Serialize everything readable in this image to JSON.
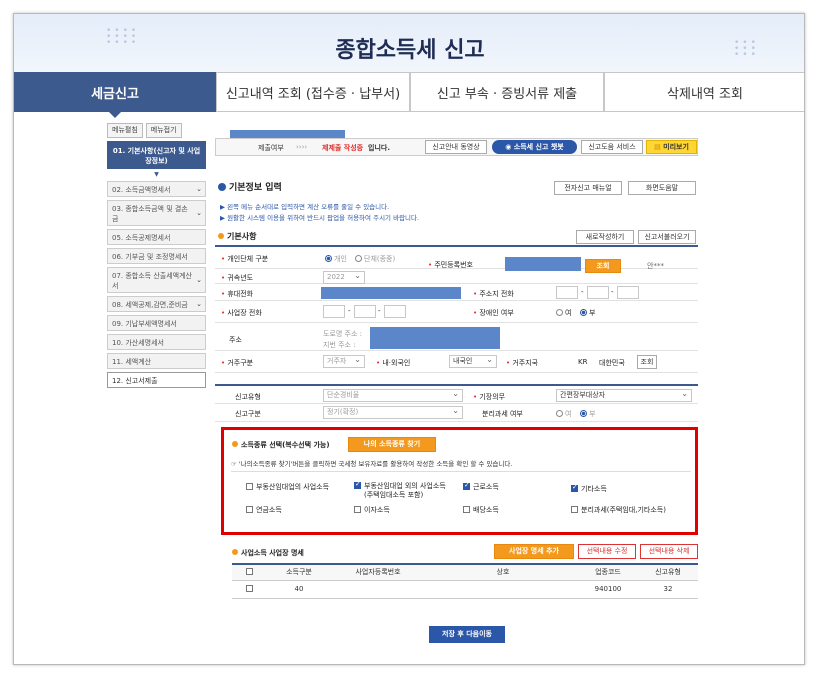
{
  "page_title": "종합소득세 신고",
  "tabs": [
    {
      "label": "세금신고",
      "active": true
    },
    {
      "label": "신고내역 조회 (접수증 · 납부서)"
    },
    {
      "label": "신고 부속 · 증빙서류 제출"
    },
    {
      "label": "삭제내역 조회"
    }
  ],
  "sidebar": {
    "expand_label": "메뉴펼침",
    "collapse_label": "메뉴접기",
    "items": [
      {
        "label": "01. 기본사항(신고자 및 사업장정보)"
      },
      {
        "label": "02. 소득금액명세서"
      },
      {
        "label": "03. 종합소득금액 및 결손금"
      },
      {
        "label": "05. 소득공제명세서"
      },
      {
        "label": "06. 기부금 및 조정명세서"
      },
      {
        "label": "07. 종합소득 산출세액계산서"
      },
      {
        "label": "08. 세액공제,감면,준비금"
      },
      {
        "label": "09. 기납부세액명세서"
      },
      {
        "label": "10. 가산세명세서"
      },
      {
        "label": "11. 세액계산"
      },
      {
        "label": "12. 신고서제출"
      }
    ]
  },
  "step": {
    "prefix": "제출여부",
    "arrows": "››››",
    "status": "제제출 작성중",
    "suffix": "입니다."
  },
  "top_buttons": {
    "video": "신고안내 동영상",
    "e_service": "소득세 신고 챗봇",
    "help_service": "신고도움 서비스",
    "preview": "미리보기"
  },
  "basic_info": {
    "title": "기본정보 입력",
    "manual_btn": "전자신고 매뉴얼",
    "screen_help_btn": "화면도움말",
    "notice1": "▶ 왼쪽 메뉴 순서대로 입력하면 계산 오류를 줄일 수 있습니다.",
    "notice2": "▶ 원활한 시스템 이용을 위하여 반드시 팝업을 허용하여 주시기 바랍니다."
  },
  "basic_facts": {
    "title": "기본사항",
    "rewrite_btn": "새로작성하기",
    "load_btn": "신고서불러오기",
    "person_type_label": "개인단체 구분",
    "person_opt1": "개인",
    "person_opt2": "단체(종중)",
    "resident_no_label": "주민등록번호",
    "lookup_btn": "조회",
    "resident_suffix": "안***",
    "year_label": "귀속년도",
    "year_value": "2022",
    "mobile_label": "휴대전화",
    "address_phone_label": "주소지 전화",
    "business_phone_label": "사업장 전화",
    "disability_label": "장애인 여부",
    "yes": "여",
    "no": "부",
    "address_label": "주소",
    "road_label": "도로명 주소 :",
    "lot_label": "지번 주소 :",
    "residence_label": "거주구분",
    "residence_value": "거주자",
    "nationality_label": "내·외국인",
    "nationality_value": "내국인",
    "country_label": "거주지국",
    "country_code": "KR",
    "country_name": "대한민국",
    "country_btn": "조회"
  },
  "report": {
    "type_label": "신고유형",
    "type_value": "단순경비율",
    "bookkeeping_label": "기장의무",
    "bookkeeping_value": "간편장부대상자",
    "category_label": "신고구분",
    "category_value": "정기(확정)",
    "separate_label": "분리과세 여부",
    "yes": "여",
    "no": "부"
  },
  "income_type": {
    "title": "소득종류 선택(복수선택 가능)",
    "find_btn": "나의 소득종류 찾기",
    "hint": "☞ '나의소득종류 찾기'버튼을 클릭하면 국세청 보유자료를 활용하여 작성한 소득을 확인 할 수 있습니다.",
    "options": [
      {
        "label": "부동산임대업의 사업소득",
        "checked": false
      },
      {
        "label": "부동산임대업 외의 사업소득",
        "sub": "(주택임대소득 포함)",
        "checked": true
      },
      {
        "label": "근로소득",
        "checked": true
      },
      {
        "label": "기타소득",
        "checked": true
      },
      {
        "label": "연금소득",
        "checked": false
      },
      {
        "label": "이자소득",
        "checked": false
      },
      {
        "label": "배당소득",
        "checked": false
      },
      {
        "label": "분리과세(주택임대,기타소득)",
        "checked": false
      }
    ]
  },
  "business": {
    "title": "사업소득 사업장 명세",
    "add_btn": "사업장 명세 추가",
    "edit_btn": "선택내용 수정",
    "delete_btn": "선택내용 삭제",
    "columns": [
      "소득구분",
      "사업자등록번호",
      "상호",
      "업종코드",
      "신고유형"
    ],
    "rows": [
      {
        "income_code": "40",
        "biz_no": "",
        "name": "",
        "industry_code": "940100",
        "type": "32"
      }
    ]
  },
  "save_btn": "저장 후 다음이동",
  "colors": {
    "accent": "#3d5a8e",
    "blue": "#2b57a8",
    "orange": "#f39a1e",
    "highlight": "#e00000"
  }
}
